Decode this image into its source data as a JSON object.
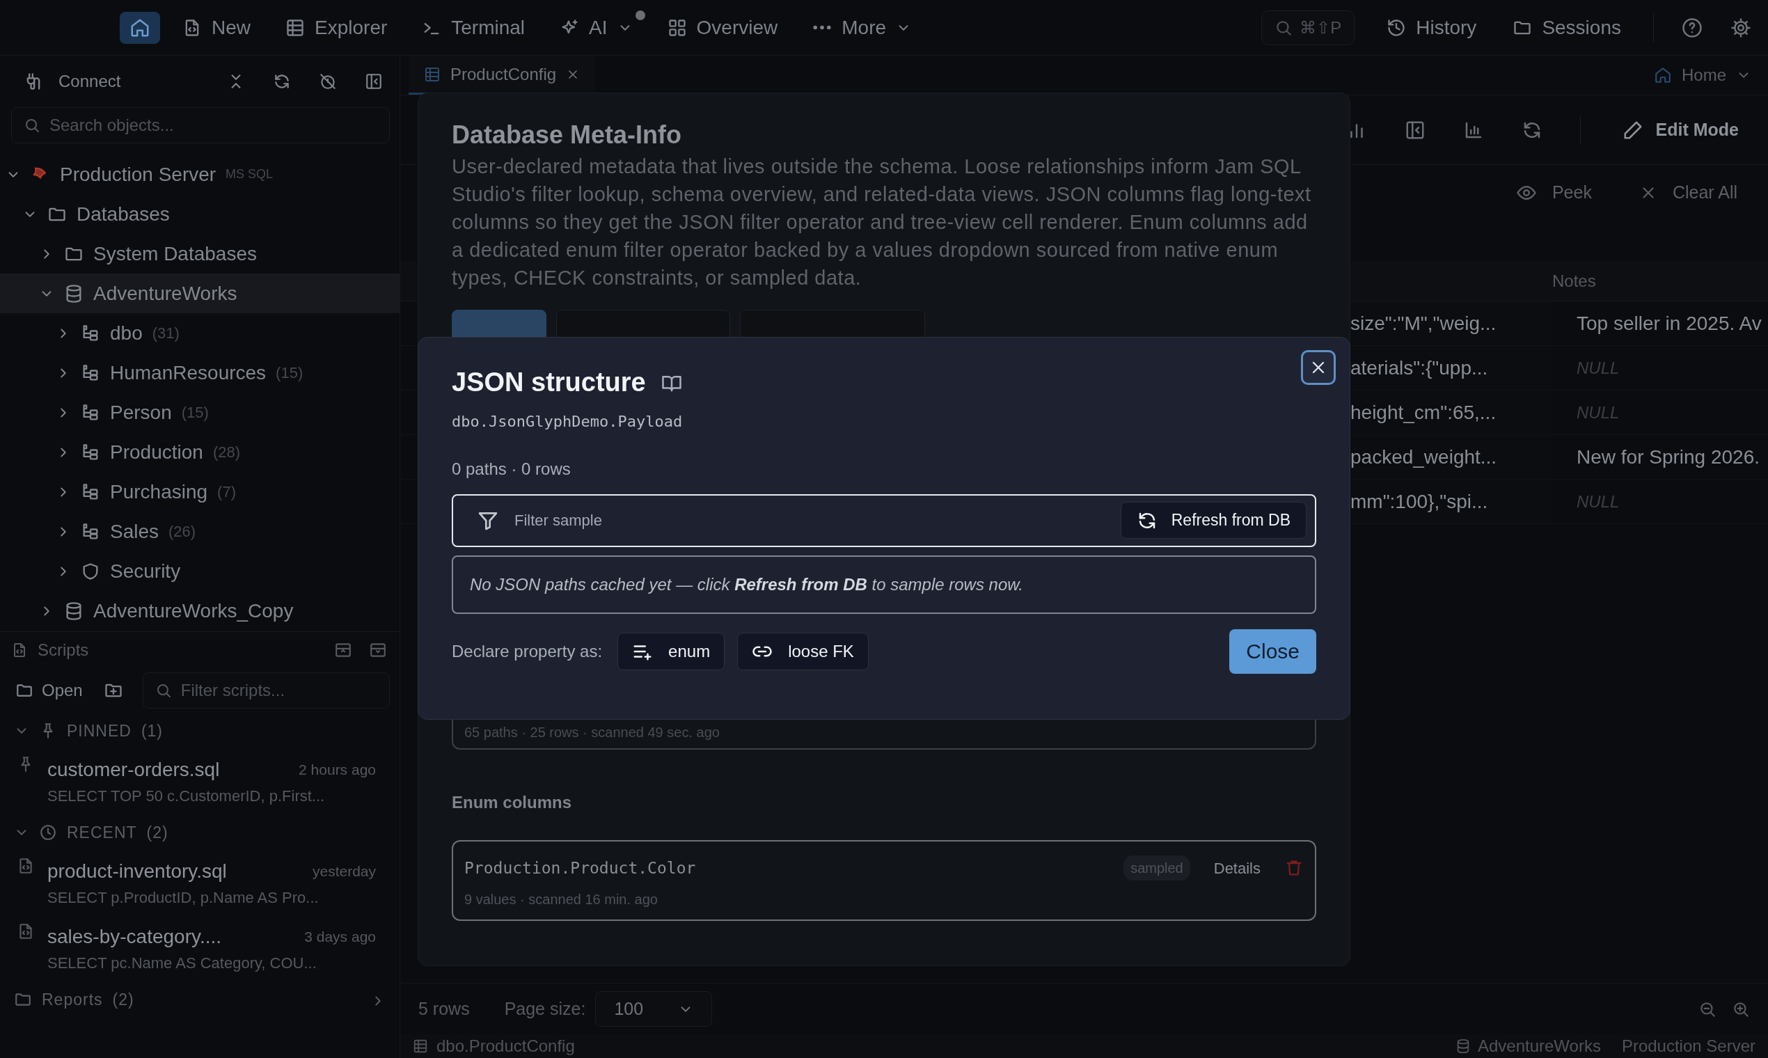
{
  "topbar": {
    "nav": [
      {
        "kind": "home",
        "selected": true
      },
      {
        "kind": "new",
        "label": "New",
        "selected": false,
        "menu": false,
        "notice": false
      },
      {
        "kind": "explorer",
        "label": "Explorer",
        "selected": false,
        "menu": false,
        "notice": false
      },
      {
        "kind": "terminal",
        "label": "Terminal",
        "selected": false,
        "menu": false,
        "notice": false
      },
      {
        "kind": "ai",
        "label": "AI",
        "selected": false,
        "menu": true,
        "notice": true
      },
      {
        "kind": "overview",
        "label": "Overview",
        "selected": false,
        "menu": false,
        "notice": false
      },
      {
        "kind": "more",
        "label": "More",
        "selected": false,
        "menu": true,
        "notice": false
      }
    ],
    "search": {
      "shortcut": "⌘⇧P"
    },
    "links": [
      {
        "kind": "history",
        "label": "History"
      },
      {
        "kind": "sessions",
        "label": "Sessions"
      }
    ]
  },
  "sidebar": {
    "connect": "Connect",
    "search": {
      "placeholder": "Search objects..."
    },
    "tree": [
      {
        "kind": "server",
        "label": "Production Server",
        "tag": "MS SQL",
        "expanded": true,
        "selected": false,
        "children": [
          {
            "kind": "folder",
            "label": "Databases",
            "expanded": true,
            "selected": false,
            "children": [
              {
                "kind": "folder",
                "label": "System Databases",
                "expanded": false,
                "selected": false
              },
              {
                "kind": "database",
                "label": "AdventureWorks",
                "expanded": true,
                "selected": true,
                "children": [
                  {
                    "kind": "schema",
                    "label": "dbo",
                    "count": "(31)",
                    "expanded": false,
                    "selected": false
                  },
                  {
                    "kind": "schema",
                    "label": "HumanResources",
                    "count": "(15)",
                    "expanded": false,
                    "selected": false
                  },
                  {
                    "kind": "schema",
                    "label": "Person",
                    "count": "(15)",
                    "expanded": false,
                    "selected": false
                  },
                  {
                    "kind": "schema",
                    "label": "Production",
                    "count": "(28)",
                    "expanded": false,
                    "selected": false
                  },
                  {
                    "kind": "schema",
                    "label": "Purchasing",
                    "count": "(7)",
                    "expanded": false,
                    "selected": false
                  },
                  {
                    "kind": "schema",
                    "label": "Sales",
                    "count": "(26)",
                    "expanded": false,
                    "selected": false
                  },
                  {
                    "kind": "security",
                    "label": "Security",
                    "expanded": false,
                    "selected": false
                  }
                ]
              },
              {
                "kind": "database",
                "label": "AdventureWorks_Copy",
                "expanded": false,
                "selected": false
              }
            ]
          }
        ]
      }
    ]
  },
  "scripts": {
    "title": "Scripts",
    "open": "Open",
    "filter": {
      "placeholder": "Filter scripts..."
    },
    "groups": [
      {
        "kind": "pinned",
        "label": "PINNED",
        "count": "(1)",
        "expanded": true,
        "items": [
          {
            "name": "customer-orders.sql",
            "time": "2 hours ago",
            "query": "SELECT TOP 50 c.CustomerID, p.First..."
          }
        ]
      },
      {
        "kind": "recent",
        "label": "RECENT",
        "count": "(2)",
        "expanded": true,
        "items": [
          {
            "name": "product-inventory.sql",
            "time": "yesterday",
            "query": "SELECT p.ProductID, p.Name AS Pro..."
          },
          {
            "name": "sales-by-category....",
            "time": "3 days ago",
            "query": "SELECT pc.Name AS Category, COU..."
          }
        ]
      },
      {
        "kind": "folder",
        "label": "Reports",
        "count": "(2)",
        "expanded": false
      }
    ]
  },
  "editor": {
    "tab": "ProductConfig",
    "home": "Home",
    "edit_mode": "Edit Mode",
    "peek": "Peek",
    "clear_all": "Clear All"
  },
  "table": {
    "notes_header": "Notes",
    "rows": [
      {
        "column_1": "size\":\"M\",\"weig...",
        "notes": "Top seller in 2025. Av",
        "is_null": false
      },
      {
        "column_1": "aterials\":{\"upp...",
        "notes": "NULL",
        "is_null": true
      },
      {
        "column_1": "height_cm\":65,...",
        "notes": "NULL",
        "is_null": true
      },
      {
        "column_1": "packed_weight...",
        "notes": "New for Spring 2026.",
        "is_null": false
      },
      {
        "column_1": "mm\":100},\"spi...",
        "notes": "NULL",
        "is_null": true
      }
    ]
  },
  "footer": {
    "rows": "5 rows",
    "page_size_label": "Page size:",
    "page_size": "100"
  },
  "status_bar": {
    "table": "dbo.ProductConfig",
    "database": "AdventureWorks",
    "server": "Production Server"
  },
  "meta_dialog": {
    "title": "Database Meta-Info",
    "description": "User-declared metadata that lives outside the schema. Loose relationships inform Jam SQL Studio's filter lookup, schema overview, and related-data views. JSON columns flag long-text columns so they get the JSON filter operator and tree-view cell renderer. Enum columns add a dedicated enum filter operator backed by a values dropdown sourced from native enum types, CHECK constraints, or sampled data.",
    "tabs": [
      {
        "selected": true
      },
      {
        "selected": false
      },
      {
        "selected": false
      }
    ],
    "json_summary": "65 paths · 25 rows · scanned 49 sec. ago",
    "enum_heading": "Enum columns",
    "enum_columns": [
      {
        "name": "Production.Product.Color",
        "source": "sampled",
        "action": "Details",
        "info": "9 values · scanned 16 min. ago"
      }
    ]
  },
  "json_dialog": {
    "title": "JSON structure",
    "column": "dbo.JsonGlyphDemo.Payload",
    "stats": "0 paths · 0 rows",
    "filter": {
      "placeholder": "Filter sample"
    },
    "refresh": "Refresh from DB",
    "empty_message": "No JSON paths cached yet — click **Refresh from DB** to sample rows now.",
    "declare_label": "Declare property as:",
    "declare_options": [
      {
        "kind": "enum",
        "label": "enum"
      },
      {
        "kind": "fk",
        "label": "loose FK"
      }
    ],
    "close": "Close"
  }
}
